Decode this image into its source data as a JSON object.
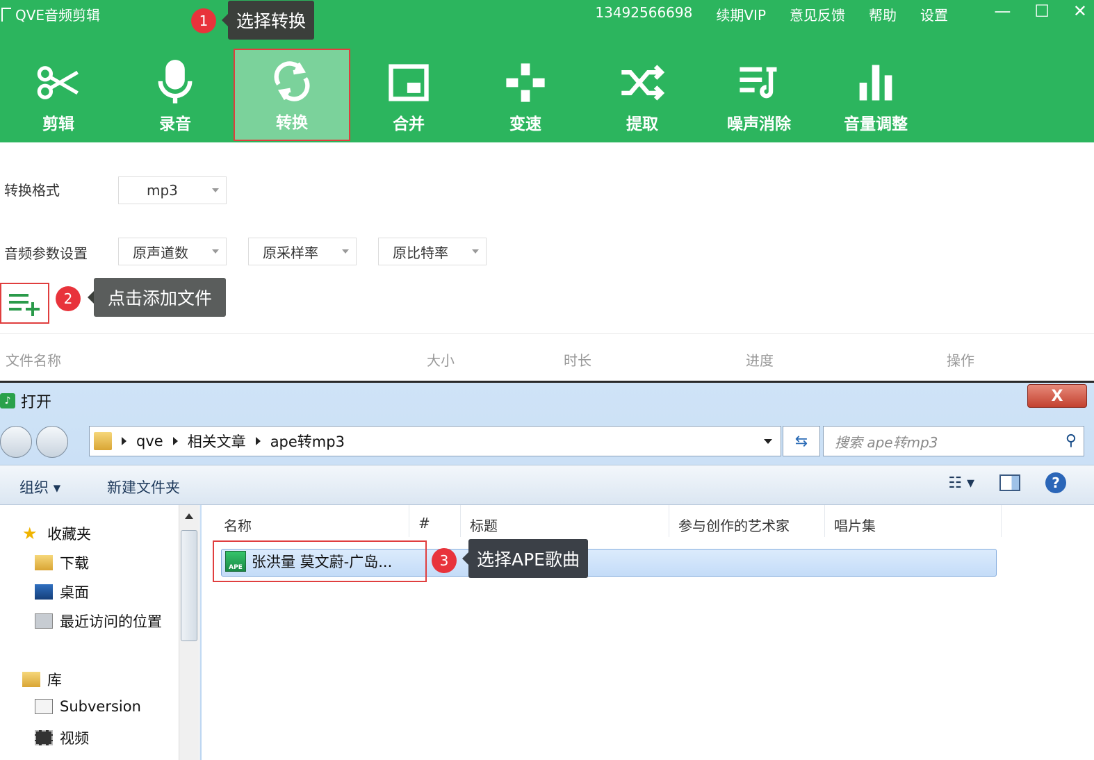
{
  "app": {
    "title": "QVE音频剪辑",
    "phone": "13492566698",
    "links": [
      "续期VIP",
      "意见反馈",
      "帮助",
      "设置"
    ],
    "window_controls": [
      "—",
      "☐",
      "✕"
    ]
  },
  "toolbar": {
    "items": [
      {
        "label": "剪辑",
        "icon": "scissors-icon"
      },
      {
        "label": "录音",
        "icon": "microphone-icon"
      },
      {
        "label": "转换",
        "icon": "convert-icon",
        "active": true
      },
      {
        "label": "合并",
        "icon": "merge-icon"
      },
      {
        "label": "变速",
        "icon": "speed-icon"
      },
      {
        "label": "提取",
        "icon": "shuffle-icon"
      },
      {
        "label": "噪声消除",
        "icon": "denoise-icon"
      },
      {
        "label": "音量调整",
        "icon": "volume-bars-icon"
      }
    ]
  },
  "callouts": {
    "step1": {
      "num": "1",
      "text": "选择转换"
    },
    "step2": {
      "num": "2",
      "text": "点击添加文件"
    },
    "step3": {
      "num": "3",
      "text": "选择APE歌曲"
    }
  },
  "settings": {
    "format_label": "转换格式",
    "format_value": "mp3",
    "params_label": "音频参数设置",
    "channels": "原声道数",
    "sample_rate": "原采样率",
    "bitrate": "原比特率"
  },
  "table": {
    "headers": [
      "文件名称",
      "大小",
      "时长",
      "进度",
      "操作"
    ]
  },
  "dialog": {
    "title": "打开",
    "close": "X",
    "breadcrumb": [
      "qve",
      "相关文章",
      "ape转mp3"
    ],
    "search_placeholder": "搜索 ape转mp3",
    "organize": "组织 ▾",
    "new_folder": "新建文件夹",
    "nav": {
      "favorites": "收藏夹",
      "downloads": "下载",
      "desktop": "桌面",
      "recent": "最近访问的位置",
      "library": "库",
      "subversion": "Subversion",
      "video": "视频"
    },
    "columns": [
      "名称",
      "#",
      "标题",
      "参与创作的艺术家",
      "唱片集"
    ],
    "file": {
      "name": "张洪量 莫文蔚-广岛...",
      "icon_text": "APE"
    }
  }
}
